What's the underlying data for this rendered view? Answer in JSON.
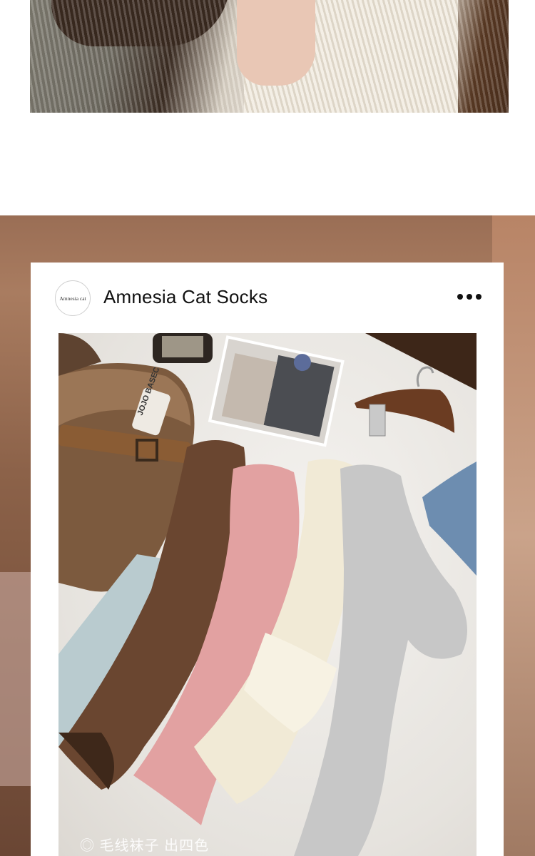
{
  "top_photo": {
    "alt_icon": "photo-icon"
  },
  "card": {
    "avatar_text": "Amnesia cat",
    "title": "Amnesia Cat Socks",
    "more_icon": "more-horizontal-icon"
  },
  "photo": {
    "clog_label": "JOJO BASEC",
    "caption": "◎ 毛线袜子 出四色",
    "colors": {
      "sock_brown": "#6a4630",
      "sock_pink": "#e2a1a1",
      "sock_cream": "#f1ead6",
      "sock_gray": "#c7c7c7",
      "sock_lightblue": "#b9cbcf",
      "sock_blue": "#6d8db0"
    }
  }
}
